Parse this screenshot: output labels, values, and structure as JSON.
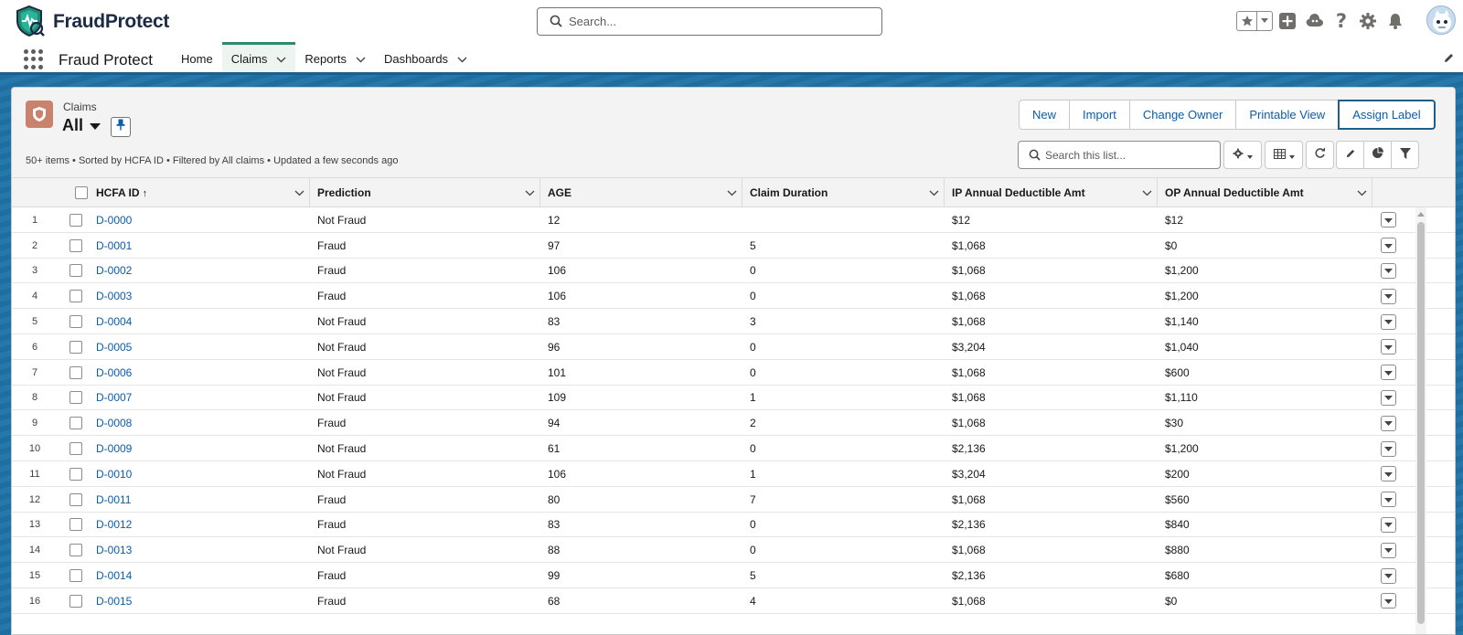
{
  "header": {
    "brand": "FraudProtect",
    "search_placeholder": "Search...",
    "icons": [
      "app-logo-icon",
      "search-icon",
      "star-icon",
      "chevron-down-icon",
      "add-icon",
      "trailhead-icon",
      "help-icon",
      "gear-icon",
      "bell-icon",
      "avatar"
    ]
  },
  "nav": {
    "app_name": "Fraud Protect",
    "tabs": [
      {
        "label": "Home",
        "dropdown": false,
        "active": false
      },
      {
        "label": "Claims",
        "dropdown": true,
        "active": true
      },
      {
        "label": "Reports",
        "dropdown": true,
        "active": false
      },
      {
        "label": "Dashboards",
        "dropdown": true,
        "active": false
      }
    ]
  },
  "list": {
    "object_label": "Claims",
    "view_name": "All",
    "info": "50+ items • Sorted by HCFA ID • Filtered by All claims • Updated a few seconds ago",
    "buttons": [
      "New",
      "Import",
      "Change Owner",
      "Printable View",
      "Assign Label"
    ],
    "search_placeholder": "Search this list...",
    "columns": [
      "HCFA ID",
      "Prediction",
      "AGE",
      "Claim Duration",
      "IP Annual Deductible Amt",
      "OP Annual Deductible Amt"
    ],
    "sort_indicator": "↑",
    "rows": [
      {
        "n": "1",
        "id": "D-0000",
        "prediction": "Not Fraud",
        "age": "12",
        "duration": "",
        "ip": "$12",
        "op": "$12"
      },
      {
        "n": "2",
        "id": "D-0001",
        "prediction": "Fraud",
        "age": "97",
        "duration": "5",
        "ip": "$1,068",
        "op": "$0"
      },
      {
        "n": "3",
        "id": "D-0002",
        "prediction": "Fraud",
        "age": "106",
        "duration": "0",
        "ip": "$1,068",
        "op": "$1,200"
      },
      {
        "n": "4",
        "id": "D-0003",
        "prediction": "Fraud",
        "age": "106",
        "duration": "0",
        "ip": "$1,068",
        "op": "$1,200"
      },
      {
        "n": "5",
        "id": "D-0004",
        "prediction": "Not Fraud",
        "age": "83",
        "duration": "3",
        "ip": "$1,068",
        "op": "$1,140"
      },
      {
        "n": "6",
        "id": "D-0005",
        "prediction": "Not Fraud",
        "age": "96",
        "duration": "0",
        "ip": "$3,204",
        "op": "$1,040"
      },
      {
        "n": "7",
        "id": "D-0006",
        "prediction": "Not Fraud",
        "age": "101",
        "duration": "0",
        "ip": "$1,068",
        "op": "$600"
      },
      {
        "n": "8",
        "id": "D-0007",
        "prediction": "Not Fraud",
        "age": "109",
        "duration": "1",
        "ip": "$1,068",
        "op": "$1,110"
      },
      {
        "n": "9",
        "id": "D-0008",
        "prediction": "Fraud",
        "age": "94",
        "duration": "2",
        "ip": "$1,068",
        "op": "$30"
      },
      {
        "n": "10",
        "id": "D-0009",
        "prediction": "Not Fraud",
        "age": "61",
        "duration": "0",
        "ip": "$2,136",
        "op": "$1,200"
      },
      {
        "n": "11",
        "id": "D-0010",
        "prediction": "Not Fraud",
        "age": "106",
        "duration": "1",
        "ip": "$3,204",
        "op": "$200"
      },
      {
        "n": "12",
        "id": "D-0011",
        "prediction": "Fraud",
        "age": "80",
        "duration": "7",
        "ip": "$1,068",
        "op": "$560"
      },
      {
        "n": "13",
        "id": "D-0012",
        "prediction": "Fraud",
        "age": "83",
        "duration": "0",
        "ip": "$2,136",
        "op": "$840"
      },
      {
        "n": "14",
        "id": "D-0013",
        "prediction": "Not Fraud",
        "age": "88",
        "duration": "0",
        "ip": "$1,068",
        "op": "$880"
      },
      {
        "n": "15",
        "id": "D-0014",
        "prediction": "Fraud",
        "age": "99",
        "duration": "5",
        "ip": "$2,136",
        "op": "$680"
      },
      {
        "n": "16",
        "id": "D-0015",
        "prediction": "Fraud",
        "age": "68",
        "duration": "4",
        "ip": "$1,068",
        "op": "$0"
      }
    ]
  },
  "colors": {
    "brand_dark": "#1b2b45",
    "link": "#0b5cab",
    "nav_active": "#2e8a6e",
    "object_icon": "#c9826d",
    "band": "#1f6ea0"
  }
}
